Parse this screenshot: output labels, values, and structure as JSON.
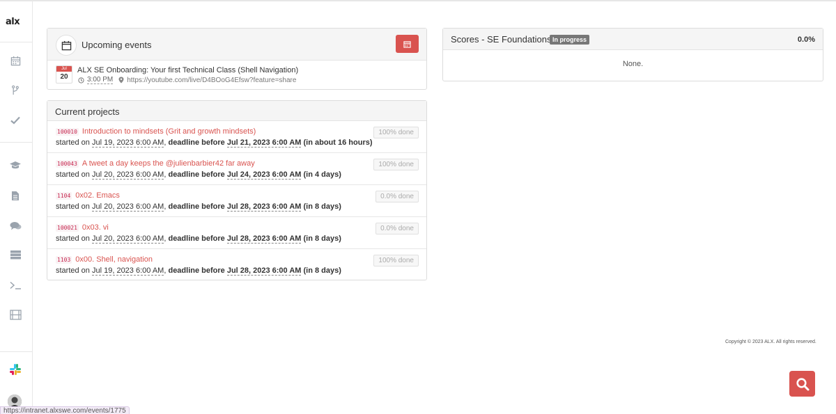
{
  "sidebar": {
    "logo": "alx",
    "icons": [
      "calendar-icon",
      "code-branch-icon",
      "check-icon",
      "graduation-cap-icon",
      "file-icon",
      "comments-icon",
      "server-icon",
      "terminal-icon",
      "film-icon",
      "slack-icon",
      "avatar"
    ]
  },
  "events": {
    "title": "Upcoming events",
    "items": [
      {
        "month": "Jul",
        "day": "20",
        "title": "ALX SE Onboarding: Your first Technical Class (Shell Navigation)",
        "time": "3:00 PM",
        "url": "https://youtube.com/live/D4BOoG4Efsw?feature=share"
      }
    ]
  },
  "projects": {
    "title": "Current projects",
    "items": [
      {
        "code": "100010",
        "name": "Introduction to mindsets (Grit and growth mindsets)",
        "started_label": "started on",
        "started": "Jul 19, 2023 6:00 AM",
        "deadline_label": "deadline before",
        "deadline": "Jul 21, 2023 6:00 AM",
        "remaining": "(in about 16 hours)",
        "done": "100% done"
      },
      {
        "code": "100043",
        "name": "A tweet a day keeps the @julienbarbier42 far away",
        "started_label": "started on",
        "started": "Jul 20, 2023 6:00 AM",
        "deadline_label": "deadline before",
        "deadline": "Jul 24, 2023 6:00 AM",
        "remaining": "(in 4 days)",
        "done": "100% done"
      },
      {
        "code": "1104",
        "name": "0x02. Emacs",
        "started_label": "started on",
        "started": "Jul 20, 2023 6:00 AM",
        "deadline_label": "deadline before",
        "deadline": "Jul 28, 2023 6:00 AM",
        "remaining": "(in 8 days)",
        "done": "0.0% done"
      },
      {
        "code": "100021",
        "name": "0x03. vi",
        "started_label": "started on",
        "started": "Jul 20, 2023 6:00 AM",
        "deadline_label": "deadline before",
        "deadline": "Jul 28, 2023 6:00 AM",
        "remaining": "(in 8 days)",
        "done": "0.0% done"
      },
      {
        "code": "1103",
        "name": "0x00. Shell, navigation",
        "started_label": "started on",
        "started": "Jul 19, 2023 6:00 AM",
        "deadline_label": "deadline before",
        "deadline": "Jul 28, 2023 6:00 AM",
        "remaining": "(in 8 days)",
        "done": "100% done"
      }
    ]
  },
  "scores": {
    "title": "Scores - SE Foundations",
    "badge": "In progress",
    "percent": "0.0%",
    "body": "None."
  },
  "footer": {
    "copyright": "Copyright © 2023 ALX. All rights reserved."
  },
  "status_bar": {
    "url": "https://intranet.alxswe.com/events/1775"
  },
  "colors": {
    "accent": "#d9534f",
    "code_text": "#c7254e",
    "icon_gray": "#9aa3ad"
  }
}
